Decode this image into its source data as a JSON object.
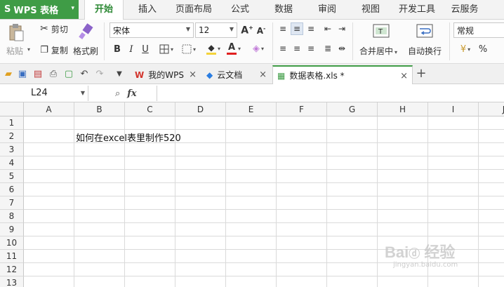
{
  "app": {
    "name": "WPS 表格"
  },
  "menu": {
    "items": [
      "开始",
      "插入",
      "页面布局",
      "公式",
      "数据",
      "审阅",
      "视图",
      "开发工具",
      "云服务"
    ],
    "active": "开始"
  },
  "ribbon": {
    "paste": "粘贴",
    "cut": "剪切",
    "copy": "复制",
    "format_painter": "格式刷",
    "font_name": "宋体",
    "font_size": "12",
    "merge_center": "合并居中",
    "wrap_text": "自动换行",
    "number_format": "常规",
    "percent": "%"
  },
  "tabs": [
    {
      "label": "我的WPS"
    },
    {
      "label": "云文档"
    },
    {
      "label": "数据表格.xls *",
      "active": true
    }
  ],
  "formula_bar": {
    "name_box": "L24",
    "fx": "fx",
    "content": ""
  },
  "sheet": {
    "columns": [
      "A",
      "B",
      "C",
      "D",
      "E",
      "F",
      "G",
      "H",
      "I",
      "J"
    ],
    "rows": [
      "1",
      "2",
      "3",
      "4",
      "5",
      "6",
      "7",
      "8",
      "9",
      "10",
      "11",
      "12",
      "13"
    ],
    "cells": [
      {
        "ref": "B2",
        "text": "如何在excel表里制作520"
      }
    ]
  },
  "watermark": {
    "brand": "Bai 经验",
    "url": "jingyan.baidu.com"
  },
  "colors": {
    "accent": "#3f9c46",
    "font_color_red": "#e02020",
    "fill_yellow": "#f4d23a"
  }
}
